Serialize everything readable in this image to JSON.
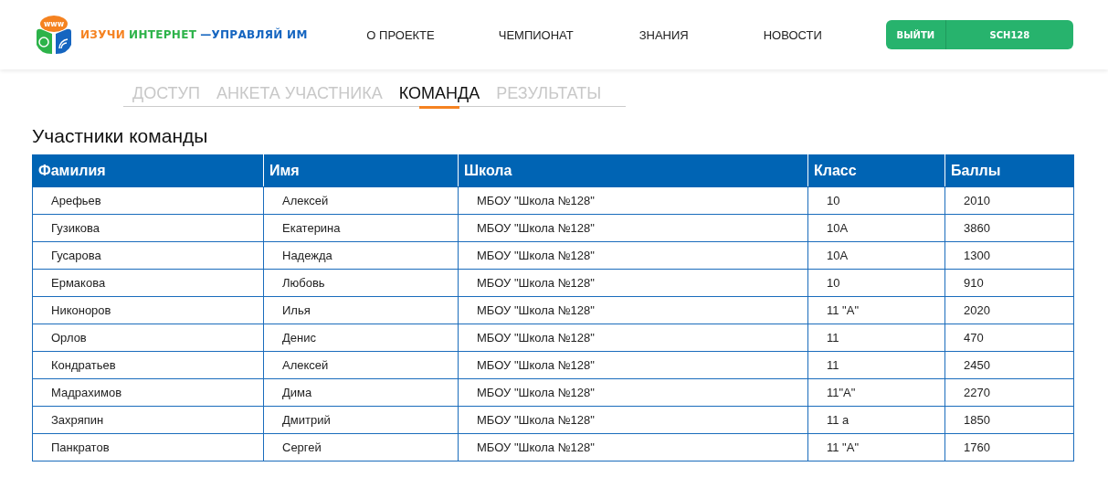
{
  "header": {
    "logo": {
      "badge": "www",
      "parts": [
        {
          "text": "ИЗУЧИ",
          "color": "#f58220"
        },
        {
          "text": "ИНТЕРНЕТ",
          "color": "#2db34a"
        },
        {
          "text": "—УПРАВЛЯЙ ИМ",
          "color": "#1565c0"
        }
      ]
    },
    "nav": [
      "О ПРОЕКТЕ",
      "ЧЕМПИОНАТ",
      "ЗНАНИЯ",
      "НОВОСТИ"
    ],
    "logout": "ВЫЙТИ",
    "user": "SCH128"
  },
  "tabs": [
    {
      "label": "ДОСТУП",
      "selected": false
    },
    {
      "label": "АНКЕТА УЧАСТНИКА",
      "selected": false
    },
    {
      "label": "КОМАНДА",
      "selected": true
    },
    {
      "label": "РЕЗУЛЬТАТЫ",
      "selected": false
    }
  ],
  "section_title": "Участники команды",
  "table": {
    "columns": [
      "Фамилия",
      "Имя",
      "Школа",
      "Класс",
      "Баллы"
    ],
    "rows": [
      [
        "Арефьев",
        "Алексей",
        "МБОУ \"Школа №128\"",
        "10",
        "2010"
      ],
      [
        "Гузикова",
        "Екатерина",
        "МБОУ \"Школа №128\"",
        "10А",
        "3860"
      ],
      [
        "Гусарова",
        "Надежда",
        "МБОУ \"Школа №128\"",
        "10А",
        "1300"
      ],
      [
        "Ермакова",
        "Любовь",
        "МБОУ \"Школа №128\"",
        "10",
        "910"
      ],
      [
        "Никоноров",
        "Илья",
        "МБОУ \"Школа №128\"",
        "11 \"А\"",
        "2020"
      ],
      [
        "Орлов",
        "Денис",
        "МБОУ \"Школа №128\"",
        "11",
        "470"
      ],
      [
        "Кондратьев",
        "Алексей",
        "МБОУ \"Школа №128\"",
        "11",
        "2450"
      ],
      [
        "Мадрахимов",
        "Дима",
        "МБОУ \"Школа №128\"",
        "11\"А\"",
        "2270"
      ],
      [
        "Захряпин",
        "Дмитрий",
        "МБОУ \"Школа №128\"",
        "11 а",
        "1850"
      ],
      [
        "Панкратов",
        "Сергей",
        "МБОУ \"Школа №128\"",
        "11 \"А\"",
        "1760"
      ]
    ]
  }
}
